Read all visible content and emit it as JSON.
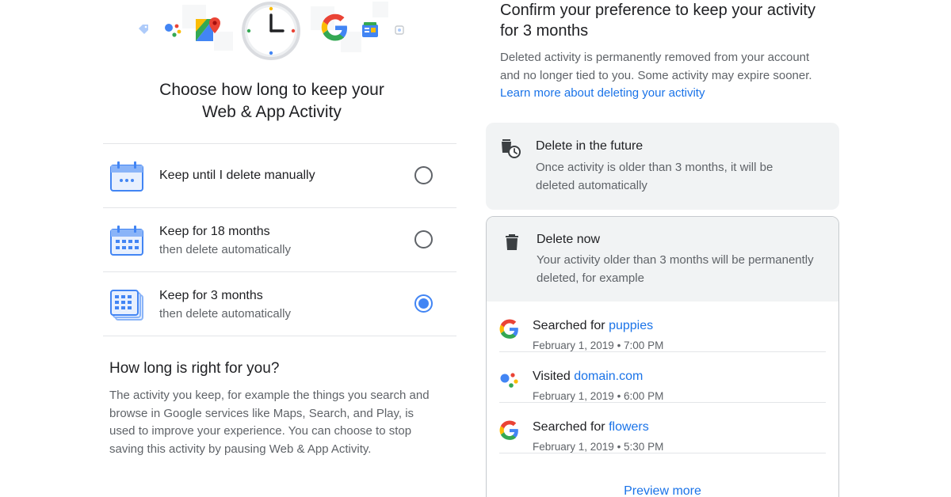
{
  "left": {
    "heading_line1": "Choose how long to keep your",
    "heading_line2": "Web & App Activity",
    "options": [
      {
        "title": "Keep until I delete manually",
        "subtitle": "",
        "selected": false,
        "icon": "calendar-icon"
      },
      {
        "title": "Keep for 18 months",
        "subtitle": "then delete automatically",
        "selected": false,
        "icon": "calendar-grid-icon"
      },
      {
        "title": "Keep for 3 months",
        "subtitle": "then delete automatically",
        "selected": true,
        "icon": "calendar-stack-icon"
      }
    ],
    "info_heading": "How long is right for you?",
    "info_text": "The activity you keep, for example the things you search and browse in Google services like Maps, Search, and Play, is used to improve your experience. You can choose to stop saving this activity by pausing Web & App Activity.",
    "hero_icons": [
      "tag-icon",
      "assistant-dots-icon",
      "maps-icon",
      "clock-icon",
      "google-g-icon",
      "news-icon",
      "photo-icon"
    ]
  },
  "right": {
    "heading": "Confirm your preference to keep your activity for 3 months",
    "desc": "Deleted activity is permanently removed from your account and no longer tied to you. Some activity may expire sooner.",
    "learn_more": "Learn more about deleting your activity",
    "future": {
      "title": "Delete in the future",
      "text": "Once activity is older than 3 months, it will be deleted automatically",
      "icon": "trash-clock-icon"
    },
    "now": {
      "title": "Delete now",
      "text": "Your activity older than 3 months will be permanently deleted, for example",
      "icon": "trash-icon"
    },
    "activities": [
      {
        "verb": "Searched for",
        "object": "puppies",
        "time": "February 1, 2019 • 7:00 PM",
        "icon": "google-g-icon"
      },
      {
        "verb": "Visited",
        "object": "domain.com",
        "time": "February 1, 2019 • 6:00 PM",
        "icon": "assistant-dots-icon"
      },
      {
        "verb": "Searched for",
        "object": "flowers",
        "time": "February 1, 2019 • 5:30 PM",
        "icon": "google-g-icon"
      }
    ],
    "preview_more": "Preview more"
  },
  "colors": {
    "accent": "#1a73e8",
    "radio_on": "#4285f4",
    "card_bg": "#f1f3f4",
    "text_primary": "#202124",
    "text_secondary": "#5f6368"
  }
}
